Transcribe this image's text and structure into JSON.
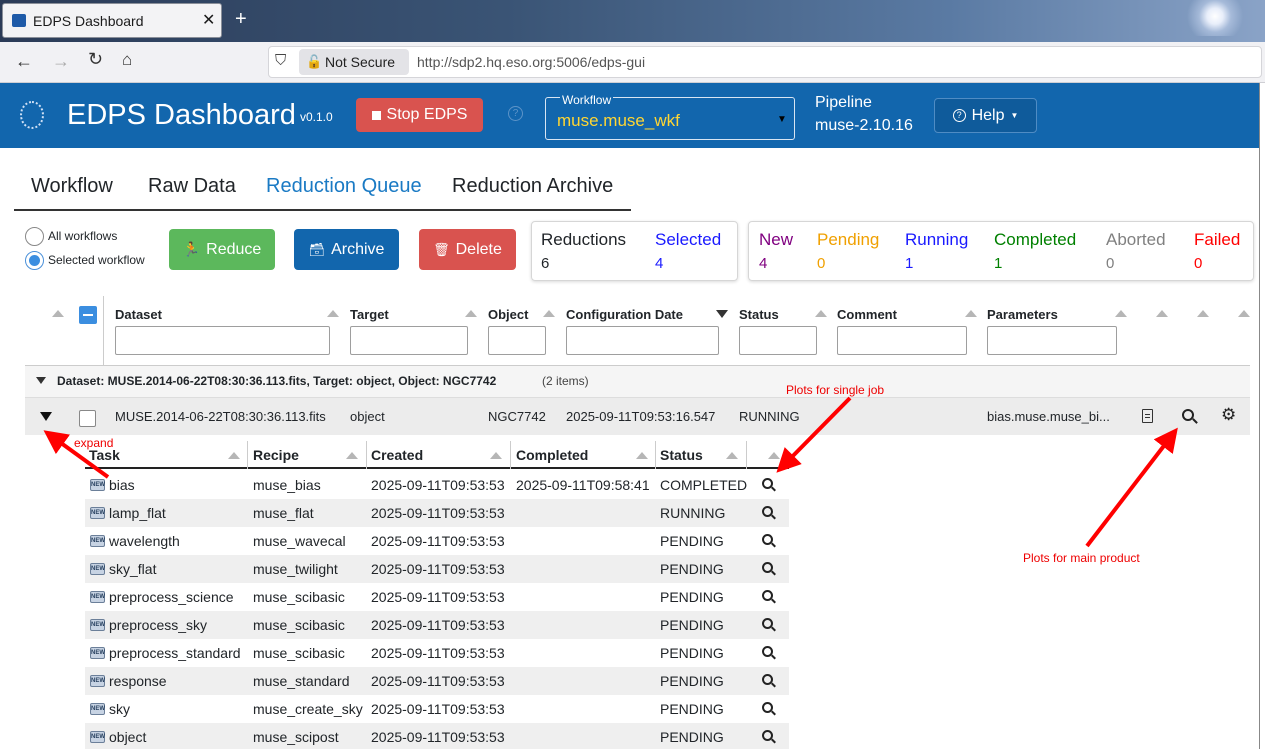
{
  "browser": {
    "tab_title": "EDPS Dashboard",
    "security_label": "Not Secure",
    "url": "http://sdp2.hq.eso.org:5006/edps-gui"
  },
  "header": {
    "title": "EDPS Dashboard",
    "version": "v0.1.0",
    "stop_label": "Stop EDPS",
    "workflow_label": "Workflow",
    "workflow_value": "muse.muse_wkf",
    "pipeline_label": "Pipeline",
    "pipeline_value": "muse-2.10.16",
    "help_label": "Help"
  },
  "nav": {
    "tabs": [
      "Workflow",
      "Raw Data",
      "Reduction Queue",
      "Reduction Archive"
    ],
    "active": "Reduction Queue"
  },
  "scope": {
    "all_label": "All workflows",
    "selected_label": "Selected workflow",
    "checked": "selected"
  },
  "actions": {
    "reduce_label": "Reduce",
    "archive_label": "Archive",
    "delete_label": "Delete"
  },
  "summary": {
    "reductions_label": "Reductions",
    "reductions_value": "6",
    "selected_label": "Selected",
    "selected_value": "4"
  },
  "status_counts": [
    {
      "label": "New",
      "value": "4",
      "color": "#800080"
    },
    {
      "label": "Pending",
      "value": "0",
      "color": "#f0a000"
    },
    {
      "label": "Running",
      "value": "1",
      "color": "#1a1aff"
    },
    {
      "label": "Completed",
      "value": "1",
      "color": "#008000"
    },
    {
      "label": "Aborted",
      "value": "0",
      "color": "#808080"
    },
    {
      "label": "Failed",
      "value": "0",
      "color": "#ff0000"
    }
  ],
  "table": {
    "columns": [
      "Dataset",
      "Target",
      "Object",
      "Configuration Date",
      "Status",
      "Comment",
      "Parameters"
    ],
    "group_label": "Dataset: MUSE.2014-06-22T08:30:36.113.fits, Target: object, Object: NGC7742",
    "group_count": "(2 items)",
    "row": {
      "dataset": "MUSE.2014-06-22T08:30:36.113.fits",
      "target": "object",
      "object": "NGC7742",
      "config_date": "2025-09-11T09:53:16.547",
      "status": "RUNNING",
      "parameters": "bias.muse.muse_bi..."
    }
  },
  "subtable": {
    "columns": [
      "Task",
      "Recipe",
      "Created",
      "Completed",
      "Status"
    ],
    "rows": [
      {
        "task": "bias",
        "recipe": "muse_bias",
        "created": "2025-09-11T09:53:53",
        "completed": "2025-09-11T09:58:41",
        "status": "COMPLETED"
      },
      {
        "task": "lamp_flat",
        "recipe": "muse_flat",
        "created": "2025-09-11T09:53:53",
        "completed": "",
        "status": "RUNNING"
      },
      {
        "task": "wavelength",
        "recipe": "muse_wavecal",
        "created": "2025-09-11T09:53:53",
        "completed": "",
        "status": "PENDING"
      },
      {
        "task": "sky_flat",
        "recipe": "muse_twilight",
        "created": "2025-09-11T09:53:53",
        "completed": "",
        "status": "PENDING"
      },
      {
        "task": "preprocess_science",
        "recipe": "muse_scibasic",
        "created": "2025-09-11T09:53:53",
        "completed": "",
        "status": "PENDING"
      },
      {
        "task": "preprocess_sky",
        "recipe": "muse_scibasic",
        "created": "2025-09-11T09:53:53",
        "completed": "",
        "status": "PENDING"
      },
      {
        "task": "preprocess_standard",
        "recipe": "muse_scibasic",
        "created": "2025-09-11T09:53:53",
        "completed": "",
        "status": "PENDING"
      },
      {
        "task": "response",
        "recipe": "muse_standard",
        "created": "2025-09-11T09:53:53",
        "completed": "",
        "status": "PENDING"
      },
      {
        "task": "sky",
        "recipe": "muse_create_sky",
        "created": "2025-09-11T09:53:53",
        "completed": "",
        "status": "PENDING"
      },
      {
        "task": "object",
        "recipe": "muse_scipost",
        "created": "2025-09-11T09:53:53",
        "completed": "",
        "status": "PENDING"
      }
    ]
  },
  "annotations": {
    "expand": "expand",
    "single_job": "Plots for single job",
    "main_product": "Plots for main product"
  }
}
